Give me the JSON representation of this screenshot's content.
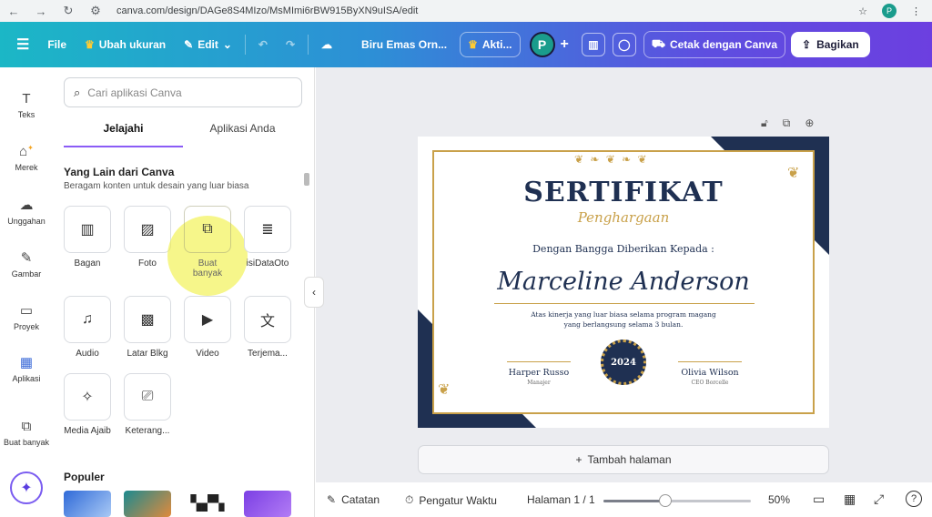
{
  "browser": {
    "url": "canva.com/design/DAGe8S4MIzo/MsMImi6rBW915ByXN9uISA/edit",
    "profile_initial": "P"
  },
  "topbar": {
    "file": "File",
    "resize": "Ubah ukuran",
    "edit": "Edit",
    "doc_title": "Biru Emas Orn...",
    "activity": "Akti...",
    "avatar_initial": "P",
    "print": "Cetak dengan Canva",
    "share": "Bagikan"
  },
  "rail": {
    "items": [
      {
        "label": "Teks",
        "icon": "text-icon"
      },
      {
        "label": "Merek",
        "icon": "brand-icon"
      },
      {
        "label": "Unggahan",
        "icon": "upload-icon"
      },
      {
        "label": "Gambar",
        "icon": "draw-icon"
      },
      {
        "label": "Proyek",
        "icon": "folder-icon"
      },
      {
        "label": "Aplikasi",
        "icon": "apps-icon"
      },
      {
        "label": "Buat banyak",
        "icon": "bulk-create-icon"
      }
    ]
  },
  "panel": {
    "search_placeholder": "Cari aplikasi Canva",
    "tabs": [
      "Jelajahi",
      "Aplikasi Anda"
    ],
    "section_title": "Yang Lain dari Canva",
    "section_subtitle": "Beragam konten untuk desain yang luar biasa",
    "apps": [
      "Bagan",
      "Foto",
      "Buat banyak",
      "isiDataOto",
      "Audio",
      "Latar Blkg",
      "Video",
      "Terjema...",
      "Media Ajaib",
      "Keterang..."
    ],
    "popular": "Populer"
  },
  "certificate": {
    "title": "SERTIFIKAT",
    "subtitle": "Penghargaan",
    "given_to": "Dengan Bangga Diberikan Kepada :",
    "name": "Marceline Anderson",
    "description_line1": "Atas kinerja yang luar biasa selama program magang",
    "description_line2": "yang berlangsung selama 3 bulan.",
    "seal_year": "2024",
    "signer1_name": "Harper Russo",
    "signer1_role": "Manajer",
    "signer2_name": "Olivia Wilson",
    "signer2_role": "CEO Borcelle"
  },
  "canvas": {
    "add_page": "Tambah halaman"
  },
  "footer": {
    "notes": "Catatan",
    "timer": "Pengatur Waktu",
    "page_indicator": "Halaman 1 / 1",
    "zoom": "50%",
    "zoom_fraction": 0.42
  },
  "colors": {
    "navy": "#1f3052",
    "gold": "#c9a14a",
    "highlight": "#f0f03c",
    "accent": "#8b5cf6"
  }
}
